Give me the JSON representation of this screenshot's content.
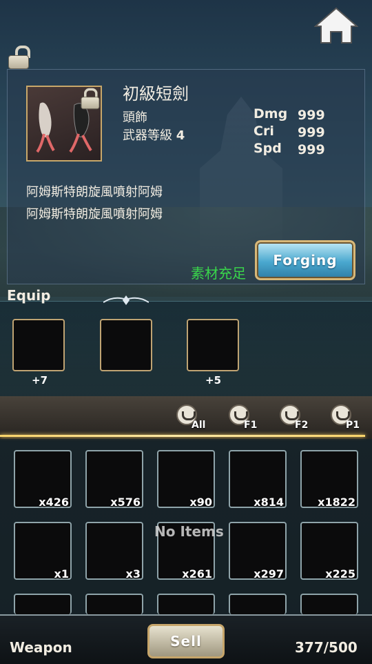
{
  "header": {
    "home_icon": "home-icon",
    "unlock_icon": "unlock-icon"
  },
  "item": {
    "name": "初級短劍",
    "type": "頭飾",
    "level_label": "武器等級",
    "level_value": "4",
    "lock_icon": "lock-icon",
    "stats": [
      {
        "label": "Dmg",
        "value": "999"
      },
      {
        "label": "Cri",
        "value": "999"
      },
      {
        "label": "Spd",
        "value": "999"
      }
    ],
    "descriptions": [
      "阿姆斯特朗旋風噴射阿姆",
      "阿姆斯特朗旋風噴射阿姆"
    ],
    "material_status": "素材充足",
    "forging_label": "Forging"
  },
  "equip": {
    "title": "Equip",
    "slots": [
      {
        "label": "+7"
      },
      {
        "label": ""
      },
      {
        "label": "+5"
      }
    ]
  },
  "filters": [
    {
      "label": "All"
    },
    {
      "label": "F1"
    },
    {
      "label": "F2"
    },
    {
      "label": "P1"
    }
  ],
  "inventory": {
    "empty_text": "No Items",
    "rows": [
      [
        "x426",
        "x576",
        "x90",
        "x814",
        "x1822"
      ],
      [
        "x1",
        "x3",
        "x261",
        "x297",
        "x225"
      ]
    ]
  },
  "footer": {
    "category": "Weapon",
    "sell_label": "Sell",
    "capacity": "377/500"
  },
  "colors": {
    "accent_gold": "#f7d36a",
    "status_green": "#39d64b",
    "button_blue": "#4aa8cf"
  }
}
